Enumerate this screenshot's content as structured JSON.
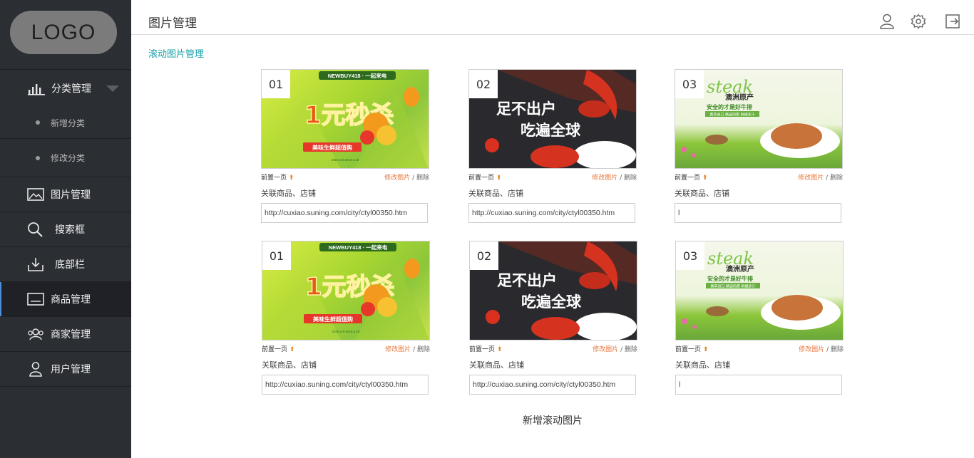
{
  "sidebar": {
    "logo": "LOGO",
    "category": {
      "label": "分类管理",
      "subitems": [
        "新增分类",
        "修改分类"
      ]
    },
    "items": [
      {
        "label": "图片管理",
        "icon": "image-icon"
      },
      {
        "label": "搜索框",
        "icon": "search-icon"
      },
      {
        "label": "底部栏",
        "icon": "download-tray-icon"
      },
      {
        "label": "商品管理",
        "icon": "product-icon",
        "active": true
      },
      {
        "label": "商家管理",
        "icon": "merchant-icon"
      },
      {
        "label": "用户管理",
        "icon": "user-icon"
      }
    ]
  },
  "header": {
    "title": "图片管理",
    "icons": [
      "user-icon",
      "gear-icon",
      "logout-icon"
    ]
  },
  "section_title": "滚动图片管理",
  "cards": [
    {
      "num": "01",
      "prev": "前置一页",
      "edit": "修改图片",
      "sep": "/",
      "del": "删除",
      "rel_label": "关联商品、店铺",
      "url": "http://cuxiao.suning.com/city/ctyl00350.htm",
      "banner": {
        "top": "NEWBUY418 · 一起来电",
        "main": "1元秒杀",
        "sub": "美味生鲜超值购",
        "date": "2016.4.8-2016.4.18"
      }
    },
    {
      "num": "02",
      "prev": "前置一页",
      "edit": "修改图片",
      "sep": "/",
      "del": "删除",
      "rel_label": "关联商品、店铺",
      "url": "http://cuxiao.suning.com/city/ctyl00350.htm",
      "banner": {
        "line1": "足不出户",
        "line2": "吃遍全球"
      }
    },
    {
      "num": "03",
      "prev": "前置一页",
      "edit": "修改图片",
      "sep": "/",
      "del": "删除",
      "rel_label": "关联商品、店铺",
      "url": "l",
      "banner": {
        "script": "steak",
        "title": "澳洲原产",
        "slogan": "安全的才是好牛排",
        "tags": "香草进口 精选肉质 鲜嫩多汁"
      }
    },
    {
      "num": "01",
      "prev": "前置一页",
      "edit": "修改图片",
      "sep": "/",
      "del": "删除",
      "rel_label": "关联商品、店铺",
      "url": "http://cuxiao.suning.com/city/ctyl00350.htm",
      "banner": {
        "top": "NEWBUY418 · 一起来电",
        "main": "1元秒杀",
        "sub": "美味生鲜超值购",
        "date": "2016.4.8-2016.4.18"
      }
    },
    {
      "num": "02",
      "prev": "前置一页",
      "edit": "修改图片",
      "sep": "/",
      "del": "删除",
      "rel_label": "关联商品、店铺",
      "url": "http://cuxiao.suning.com/city/ctyl00350.htm",
      "banner": {
        "line1": "足不出户",
        "line2": "吃遍全球"
      }
    },
    {
      "num": "03",
      "prev": "前置一页",
      "edit": "修改图片",
      "sep": "/",
      "del": "删除",
      "rel_label": "关联商品、店铺",
      "url": "l",
      "banner": {
        "script": "steak",
        "title": "澳洲原产",
        "slogan": "安全的才是好牛排",
        "tags": "香草进口 精选肉质 鲜嫩多汁"
      }
    }
  ],
  "add_button": "新增滚动图片",
  "colors": {
    "sidebar_bg": "#2b2e33",
    "accent": "#17a0a8",
    "edit_link": "#e8763a",
    "active_bar": "#4a90d9"
  }
}
